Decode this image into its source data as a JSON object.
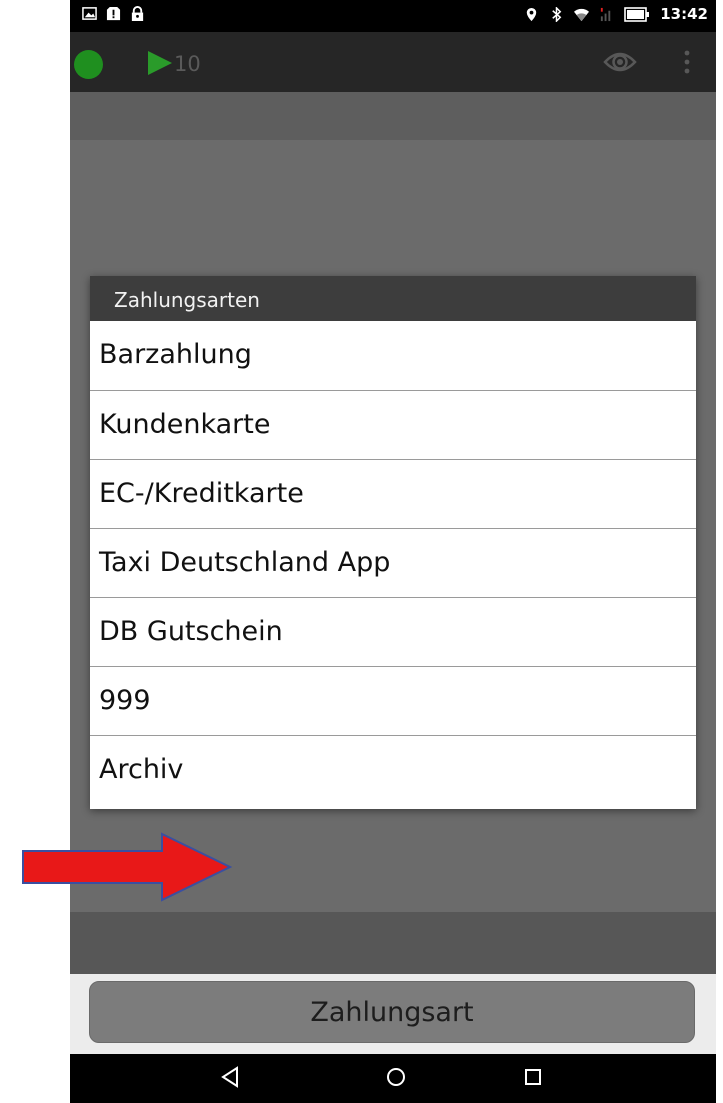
{
  "status_bar": {
    "time": "13:42"
  },
  "action_bar": {
    "counter": "10"
  },
  "dialog": {
    "title": "Zahlungsarten",
    "items": [
      "Barzahlung",
      "Kundenkarte",
      "EC-/Kreditkarte",
      "Taxi Deutschland App",
      "DB Gutschein",
      "999",
      "Archiv"
    ]
  },
  "bottom": {
    "button_label": "Zahlungsart"
  },
  "colors": {
    "status_green": "#1f8f1f",
    "annotation_arrow": "#e81818"
  }
}
